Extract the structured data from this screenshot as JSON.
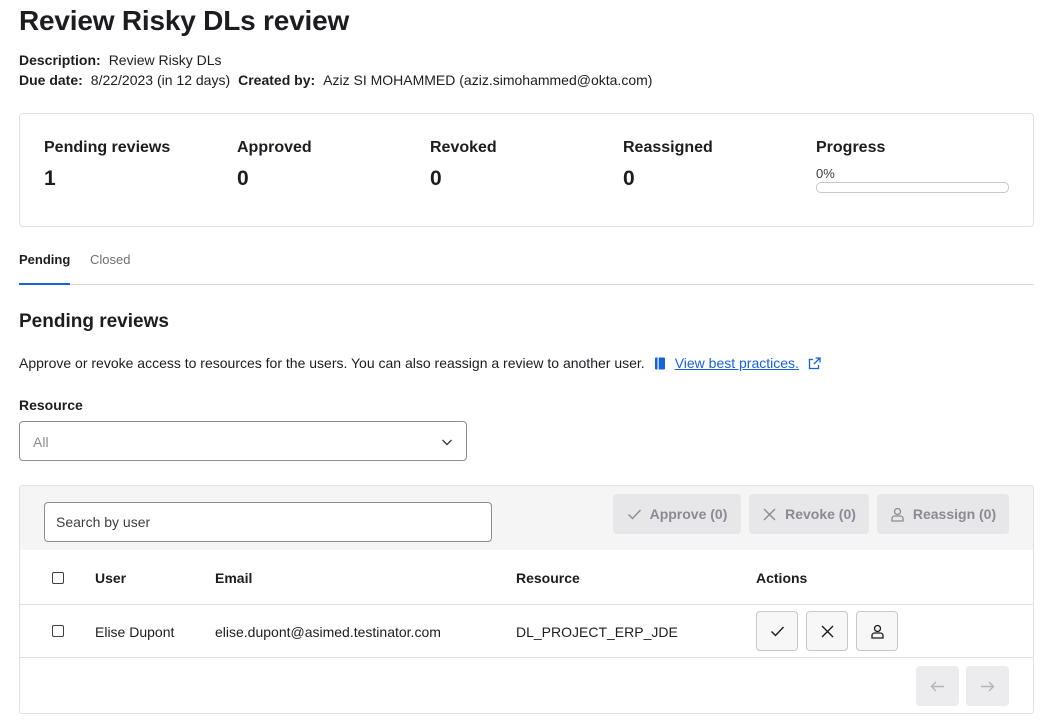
{
  "page": {
    "title": "Review Risky DLs review",
    "description_label": "Description:",
    "description_value": "Review Risky DLs",
    "due_label": "Due date:",
    "due_value": "8/22/2023 (in 12 days)",
    "created_label": "Created by:",
    "created_value": "Aziz SI MOHAMMED (aziz.simohammed@okta.com)"
  },
  "stats": {
    "pending_label": "Pending reviews",
    "pending_value": "1",
    "approved_label": "Approved",
    "approved_value": "0",
    "revoked_label": "Revoked",
    "revoked_value": "0",
    "reassigned_label": "Reassigned",
    "reassigned_value": "0",
    "progress_label": "Progress",
    "progress_text": "0%",
    "progress_fraction": 0
  },
  "tabs": [
    {
      "label": "Pending",
      "active": true
    },
    {
      "label": "Closed",
      "active": false
    }
  ],
  "section": {
    "title": "Pending reviews",
    "description": "Approve or revoke access to resources for the users. You can also reassign a review to another user.",
    "link_label": "View best practices.",
    "book_icon": "book-icon",
    "external_icon": "external-link-icon"
  },
  "filter": {
    "label": "Resource",
    "value": "All",
    "icon": "chevron-down-icon"
  },
  "table": {
    "search_placeholder": "Search by user",
    "approve_label": "Approve (0)",
    "revoke_label": "Revoke (0)",
    "reassign_label": "Reassign (0)",
    "columns": [
      "User",
      "Email",
      "Resource",
      "Actions"
    ],
    "rows": [
      {
        "user": "Elise Dupont",
        "email": "elise.dupont@asimed.testinator.com",
        "resource": "DL_PROJECT_ERP_JDE"
      }
    ]
  },
  "colors": {
    "accent": "#1662dd",
    "disabled_button_bg": "#e7e7ea",
    "disabled_button_text": "#8a8a93",
    "toolbar_bg": "#f5f5f6"
  }
}
